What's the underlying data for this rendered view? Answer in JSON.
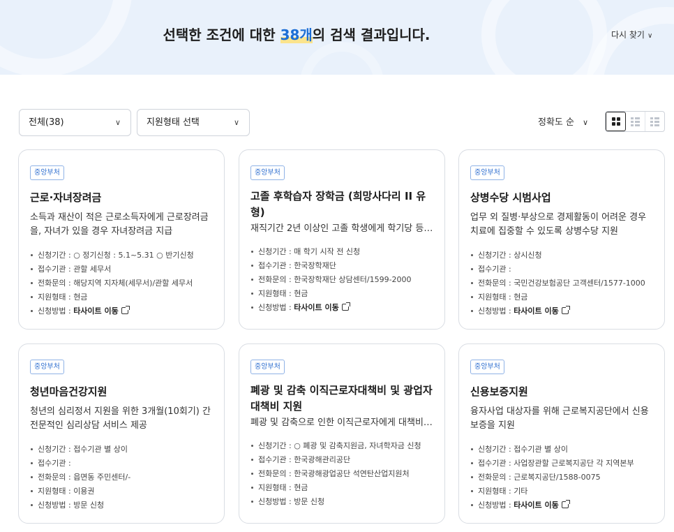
{
  "header": {
    "title_prefix": "선택한 조건에 대한 ",
    "count": "38개",
    "title_suffix": "의 검색 결과입니다.",
    "research_label": "다시 찾기"
  },
  "filters": {
    "category": "전체(38)",
    "support_type": "지원형태 선택"
  },
  "sort": {
    "label": "정확도 순"
  },
  "view": {
    "modes": [
      "grid-4",
      "list-a",
      "list-b"
    ],
    "active": "grid-4"
  },
  "cards": [
    {
      "badge": "중앙부처",
      "title": "근로·자녀장려금",
      "desc": "소득과 재산이 적은 근로소득자에게 근로장려금을, 자녀가 있을 경우 자녀장려금 지급",
      "info": [
        {
          "label": "신청기간 : ",
          "value": "○ 정기신청 : 5.1~5.31 ○ 반기신청"
        },
        {
          "label": "접수기관 : ",
          "value": "관할 세무서"
        },
        {
          "label": "전화문의 : ",
          "value": "해당지역 지자체(세무서)/관할 세무서"
        },
        {
          "label": "지원형태 : ",
          "value": "현금"
        },
        {
          "label": "신청방법 : ",
          "value": "타사이트 이동",
          "link": true
        }
      ]
    },
    {
      "badge": "중앙부처",
      "title": "고졸 후학습자 장학금 (희망사다리 II 유형)",
      "desc": "재직기간 2년 이상인 고졸 학생에게 학기당 등록금 지원",
      "info": [
        {
          "label": "신청기간 : ",
          "value": "매 학기 시작 전 신청"
        },
        {
          "label": "접수기관 : ",
          "value": "한국장학재단"
        },
        {
          "label": "전화문의 : ",
          "value": "한국장학재단 상담센터/1599-2000"
        },
        {
          "label": "지원형태 : ",
          "value": "현금"
        },
        {
          "label": "신청방법 : ",
          "value": "타사이트 이동",
          "link": true
        }
      ]
    },
    {
      "badge": "중앙부처",
      "title": "상병수당 시범사업",
      "desc": "업무 외 질병·부상으로 경제활동이 어려운 경우 치료에 집중할 수 있도록 상병수당 지원",
      "info": [
        {
          "label": "신청기간 : ",
          "value": "상시신청"
        },
        {
          "label": "접수기관 : ",
          "value": ""
        },
        {
          "label": "전화문의 : ",
          "value": "국민건강보험공단 고객센터/1577-1000"
        },
        {
          "label": "지원형태 : ",
          "value": "현금"
        },
        {
          "label": "신청방법 : ",
          "value": "타사이트 이동",
          "link": true
        }
      ]
    },
    {
      "badge": "중앙부처",
      "title": "청년마음건강지원",
      "desc": "청년의 심리정서 지원을 위한 3개월(10회기) 간 전문적인 심리상담 서비스 제공",
      "info": [
        {
          "label": "신청기간 : ",
          "value": "접수기관 별 상이"
        },
        {
          "label": "접수기관 : ",
          "value": ""
        },
        {
          "label": "전화문의 : ",
          "value": "읍면동 주민센터/-"
        },
        {
          "label": "지원형태 : ",
          "value": "이용권"
        },
        {
          "label": "신청방법 : ",
          "value": "방문 신청"
        }
      ]
    },
    {
      "badge": "중앙부처",
      "title": "폐광 및 감축 이직근로자대책비 및 광업자대책비 지원",
      "desc": "폐광 및 감축으로 인한 이직근로자에게 대책비 지원",
      "info": [
        {
          "label": "신청기간 : ",
          "value": "○ 폐광 및 감축지원금, 자녀학자금 신청"
        },
        {
          "label": "접수기관 : ",
          "value": "한국광해관리공단"
        },
        {
          "label": "전화문의 : ",
          "value": "한국광해광업공단 석연탄산업지원처"
        },
        {
          "label": "지원형태 : ",
          "value": "현금"
        },
        {
          "label": "신청방법 : ",
          "value": "방문 신청"
        }
      ]
    },
    {
      "badge": "중앙부처",
      "title": "신용보증지원",
      "desc": "융자사업 대상자를 위해 근로복지공단에서 신용보증을 지원",
      "info": [
        {
          "label": "신청기간 : ",
          "value": "접수기관 별 상이"
        },
        {
          "label": "접수기관 : ",
          "value": "사업장관할 근로복지공단 각 지역본부"
        },
        {
          "label": "전화문의 : ",
          "value": "근로복지공단/1588-0075"
        },
        {
          "label": "지원형태 : ",
          "value": "기타"
        },
        {
          "label": "신청방법 : ",
          "value": "타사이트 이동",
          "link": true
        }
      ]
    }
  ]
}
